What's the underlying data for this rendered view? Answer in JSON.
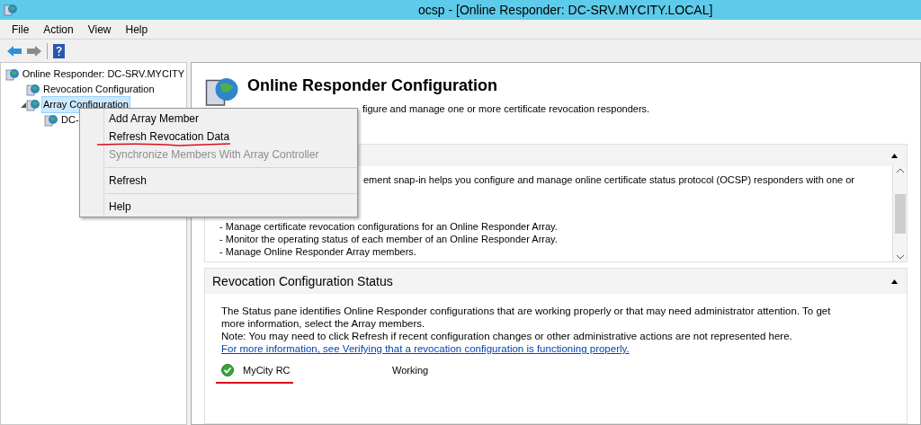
{
  "window": {
    "title": "ocsp - [Online Responder: DC-SRV.MYCITY.LOCAL]"
  },
  "menu_bar": [
    "File",
    "Action",
    "View",
    "Help"
  ],
  "tree": [
    {
      "label": "Online Responder: DC-SRV.MYCITY",
      "selected": false,
      "children": [
        {
          "label": "Revocation Configuration",
          "selected": false
        },
        {
          "label": "Array Configuration",
          "selected": true,
          "expanded": true,
          "children": [
            {
              "label": "DC-",
              "selected": false
            }
          ]
        }
      ]
    }
  ],
  "context_menu": [
    {
      "kind": "item",
      "label": "Add Array Member",
      "disabled": false
    },
    {
      "kind": "item",
      "label": "Refresh Revocation Data",
      "disabled": false
    },
    {
      "kind": "item",
      "label": "Synchronize Members With Array Controller",
      "disabled": true
    },
    {
      "kind": "separator"
    },
    {
      "kind": "item",
      "label": "Refresh",
      "disabled": false
    },
    {
      "kind": "separator"
    },
    {
      "kind": "item",
      "label": "Help",
      "disabled": false
    }
  ],
  "header": {
    "title": "Online Responder Configuration",
    "subtitle": "figure and manage one or more certificate revocation responders."
  },
  "overview_panel": {
    "expanded": true,
    "intro": "ement snap-in helps you configure and manage online certificate status protocol (OCSP) responders with one or",
    "items": [
      "-  Manage certificate revocation configurations for an Online Responder Array.",
      "-  Monitor the operating status of each member of an Online Responder Array.",
      "-  Manage Online Responder Array members."
    ]
  },
  "status_panel": {
    "title": "Revocation Configuration Status",
    "expanded": true,
    "paragraphs": [
      "The Status pane identifies Online Responder configurations that are working properly or that may need administrator attention. To get more information, select the Array members.",
      "Note: You may need to click Refresh if recent configuration changes or other administrative actions are not represented here."
    ],
    "link": "For more information, see Verifying that a revocation configuration is functioning properly.",
    "rows": [
      {
        "name": "MyCity RC",
        "status": "Working"
      }
    ]
  }
}
